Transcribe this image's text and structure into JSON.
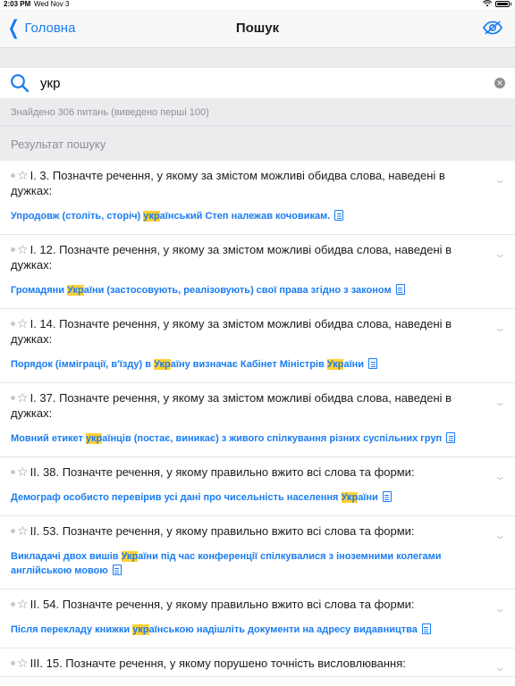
{
  "status": {
    "time": "2:03 PM",
    "date": "Wed Nov 3",
    "battery_icon": "battery-icon",
    "wifi_icon": "wifi-icon"
  },
  "nav": {
    "back_label": "Головна",
    "title": "Пошук",
    "eye_icon": "eye-icon"
  },
  "search": {
    "value": "укр",
    "placeholder": ""
  },
  "found_text": "Знайдено 306 питань (виведено перші 100)",
  "section_title": "Результат пошуку",
  "colors": {
    "accent": "#1a7cf2",
    "highlight": "#ffd033",
    "background": "#ececef"
  },
  "results": [
    {
      "question": "I. 3. Позначте речення, у якому за змістом можливі обидва слова, наведені в дужках:",
      "answer_parts": [
        "Упродовж (століть, сторіч) ",
        "укр",
        "аїнський Степ належав кочовикам."
      ]
    },
    {
      "question": "I. 12. Позначте речення, у якому за змістом можливі обидва слова, наведені в дужках:",
      "answer_parts": [
        "Громадяни ",
        "Укр",
        "аїни (застосовують, реалізовують) свої права згідно з законом"
      ]
    },
    {
      "question": "I. 14. Позначте речення, у якому за змістом можливі обидва слова, наведені в дужках:",
      "answer_parts": [
        "Порядок (імміграції, в'їзду) в ",
        "Укр",
        "аїну визначає Кабінет Міністрів ",
        "Укр",
        "аїни"
      ]
    },
    {
      "question": "I. 37. Позначте речення, у якому за змістом можливі обидва слова, наведені в дужках:",
      "answer_parts": [
        "Мовний етикет ",
        "укр",
        "аїнців (постає, виникає) з живого спілкування різних суспільних груп"
      ]
    },
    {
      "question": "II. 38. Позначте речення, у якому правильно вжито всі слова та форми:",
      "answer_parts": [
        "Демограф особисто перевірив усі дані про чисельність населення ",
        "Укр",
        "аїни"
      ]
    },
    {
      "question": "II. 53. Позначте речення, у якому правильно вжито всі слова та форми:",
      "answer_parts": [
        "Викладачі двох вишів ",
        "Укр",
        "аїни під час конференції спілкувалися з іноземними колегами англійською мовою"
      ]
    },
    {
      "question": "II. 54. Позначте речення, у якому правильно вжито всі слова та форми:",
      "answer_parts": [
        "Після перекладу книжки ",
        "укр",
        "аїнською надішліть документи на адресу видавництва"
      ]
    },
    {
      "question": "III. 15. Позначте речення, у якому порушено точність висловлювання:",
      "answer_parts": []
    }
  ]
}
